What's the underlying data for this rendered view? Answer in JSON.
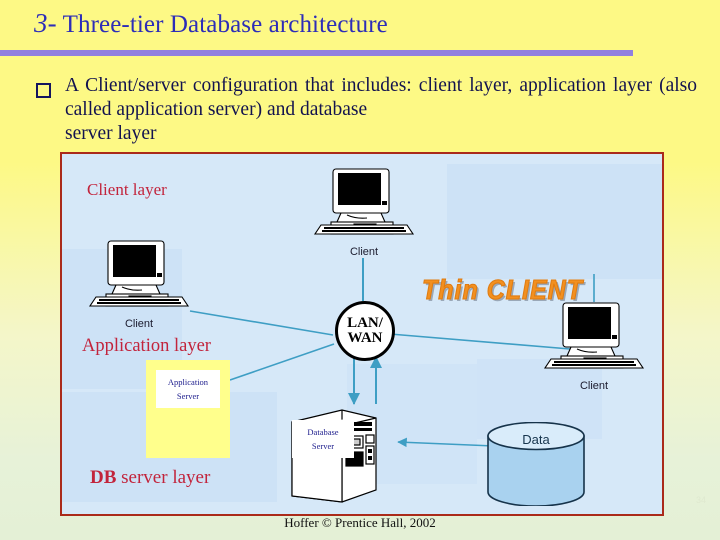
{
  "slide": {
    "title_number": "3-",
    "title_text": " Three-tier Database architecture",
    "bullet_marker": "square-bullet",
    "bullet_text": "A  Client/server  configuration  that  includes:  client  layer, application layer (also called application server) and database",
    "bullet_text_lastline": "server layer",
    "footer": "Hoffer © Prentice Hall, 2002",
    "page_number": "34"
  },
  "diagram": {
    "labels": {
      "client_layer": "Client layer",
      "application_layer": "Application layer",
      "db_layer_bold": "DB",
      "db_layer_rest": " server  layer"
    },
    "network_node": {
      "line1": "LAN/",
      "line2": "WAN"
    },
    "thin_client": "Thin CLIENT",
    "nodes": [
      {
        "id": "pc-left",
        "caption": "Client"
      },
      {
        "id": "pc-top",
        "caption": "Client"
      },
      {
        "id": "pc-right",
        "caption": "Client"
      }
    ],
    "app_server": {
      "line1": "Application",
      "line2": "Server"
    },
    "db_server": {
      "line1": "Database",
      "line2": "Server"
    },
    "data_store": "Data"
  },
  "colors": {
    "title": "#2d2db8",
    "rule": "#9180e0",
    "body_text": "#13134f",
    "layer_label": "#c2243c",
    "diagram_border": "#aa2a1a",
    "diagram_bg": "#d6e8f8",
    "connector": "#3e9ec4",
    "thin_client": "#f29020",
    "app_server_box": "#ffff8c",
    "data_cylinder": "#a9d2ef",
    "slide_bg_top": "#fdf985",
    "slide_bg_bottom": "#e4f0d6"
  }
}
